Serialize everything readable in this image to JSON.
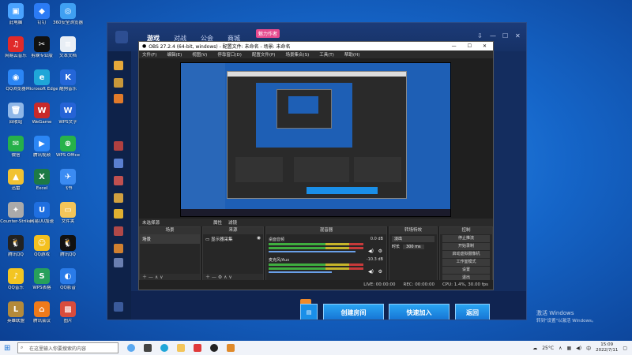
{
  "desktop_icons": [
    {
      "label": "此电脑",
      "color": "#4aa3ff",
      "glyph": "▣"
    },
    {
      "label": "网易云音乐",
      "color": "#e02a2a",
      "glyph": "♫"
    },
    {
      "label": "QQ浏览器",
      "color": "#2b86f5",
      "glyph": "◉"
    },
    {
      "label": "回收站",
      "color": "#8fb7e8",
      "glyph": "🗑"
    },
    {
      "label": "微信",
      "color": "#26b04a",
      "glyph": "✉"
    },
    {
      "label": "迅雷",
      "color": "#f1c232",
      "glyph": "▲"
    },
    {
      "label": "Counter-Strike",
      "color": "#aaaaaa",
      "glyph": "✦"
    },
    {
      "label": "腾讯QQ",
      "color": "#222",
      "glyph": "🐧"
    },
    {
      "label": "QQ音乐",
      "color": "#f3c522",
      "glyph": "♪"
    },
    {
      "label": "英雄联盟",
      "color": "#b48a3a",
      "glyph": "L"
    },
    {
      "label": "钉钉",
      "color": "#2b7bf5",
      "glyph": "◆"
    },
    {
      "label": "剪映专业版",
      "color": "#111",
      "glyph": "✂"
    },
    {
      "label": "Microsoft Edge",
      "color": "#1fa6d8",
      "glyph": "e"
    },
    {
      "label": "WeGame",
      "color": "#c82a2a",
      "glyph": "W"
    },
    {
      "label": "腾讯视频",
      "color": "#2b86f5",
      "glyph": "▶"
    },
    {
      "label": "Excel",
      "color": "#1d7a45",
      "glyph": "X"
    },
    {
      "label": "网易UU加速",
      "color": "#1f6fe0",
      "glyph": "U"
    },
    {
      "label": "QQ游戏",
      "color": "#f4c01e",
      "glyph": "☺"
    },
    {
      "label": "WPS表格",
      "color": "#27a05c",
      "glyph": "S"
    },
    {
      "label": "腾讯会议",
      "color": "#ee7a1a",
      "glyph": "⌂"
    },
    {
      "label": "360安全浏览器",
      "color": "#3fa0f2",
      "glyph": "◎"
    },
    {
      "label": "文本文档",
      "color": "#e8eef5",
      "glyph": "≡"
    },
    {
      "label": "酷狗音乐",
      "color": "#2466d8",
      "glyph": "K"
    },
    {
      "label": "WPS文字",
      "color": "#2563d6",
      "glyph": "W"
    },
    {
      "label": "WPS Office",
      "color": "#27b24a",
      "glyph": "⊕"
    },
    {
      "label": "飞书",
      "color": "#3b8bf2",
      "glyph": "✈"
    },
    {
      "label": "文件夹",
      "color": "#f3c55a",
      "glyph": "▭"
    },
    {
      "label": "腾讯QQ",
      "color": "#111",
      "glyph": "🐧"
    },
    {
      "label": "QQ影音",
      "color": "#2a7be8",
      "glyph": "◐"
    },
    {
      "label": "图片",
      "color": "#d84c3c",
      "glyph": "▩"
    }
  ],
  "client": {
    "tabs": [
      "游戏",
      "对战",
      "公会",
      "商城"
    ],
    "badge": "魅力作者",
    "buttons": [
      "创建房间",
      "快速加入",
      "返回"
    ]
  },
  "obs": {
    "title": "OBS 27.2.4 (64-bit, windows) - 配置文件: 未命名 - 场景: 未命名",
    "menu": [
      "文件(F)",
      "编辑(E)",
      "视图(V)",
      "停靠窗口(D)",
      "配置文件(P)",
      "场景集合(S)",
      "工具(T)",
      "帮助(H)"
    ],
    "no_source": "未选择源",
    "props": "属性",
    "filters": "滤镜",
    "panels": {
      "scenes": "场景",
      "sources": "来源",
      "mixer": "混音器",
      "transitions": "转场特效",
      "controls": "控制"
    },
    "scene_item": "场景",
    "source_item": "显示器采集",
    "mixer_tracks": [
      {
        "name": "桌面音频",
        "db": "0.0 dB"
      },
      {
        "name": "麦克风/Aux",
        "db": "-10.3 dB"
      }
    ],
    "transition": {
      "type": "淡出",
      "duration_label": "时长",
      "duration": "300 ms"
    },
    "controls": [
      "停止推流",
      "开始录制",
      "启动虚拟摄像机",
      "工作室模式",
      "设置",
      "退出"
    ],
    "status": {
      "live": "LIVE: 00:00:00",
      "rec": "REC: 00:00:00",
      "cpu": "CPU: 1.4%, 30.00 fps"
    }
  },
  "taskbar": {
    "search_placeholder": "在这里输入你要搜索的内容",
    "weather": "25°C",
    "ime": "中",
    "time": "15:09",
    "date": "2022/7/11"
  },
  "watermark": {
    "line1": "激活 Windows",
    "line2": "转到\"设置\"以激活 Windows。"
  }
}
